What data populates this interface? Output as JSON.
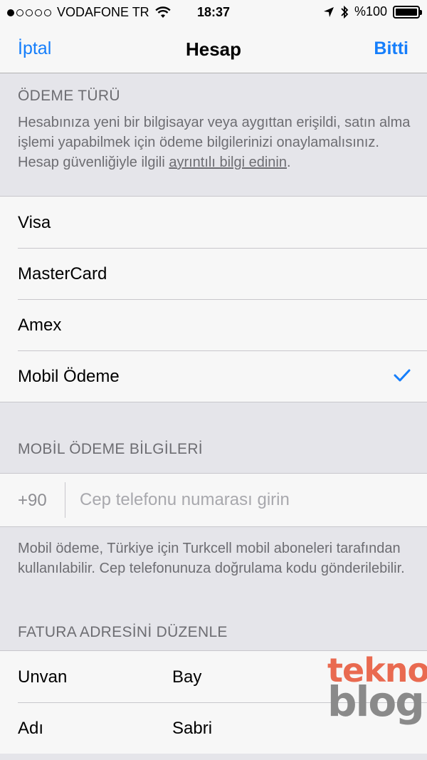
{
  "status_bar": {
    "carrier": "VODAFONE TR",
    "time": "18:37",
    "battery": "%100",
    "signal_dots_filled": 1,
    "signal_dots_total": 5
  },
  "nav": {
    "cancel": "İptal",
    "title": "Hesap",
    "done": "Bitti"
  },
  "payment_type": {
    "header": "ÖDEME TÜRÜ",
    "description": "Hesabınıza yeni bir bilgisayar veya aygıttan erişildi, satın alma işlemi yapabilmek için ödeme bilgilerinizi onaylamalısınız. Hesap güvenliğiyle ilgili ",
    "link": "ayrıntılı bilgi edinin",
    "description_end": ".",
    "options": [
      {
        "label": "Visa",
        "selected": false
      },
      {
        "label": "MasterCard",
        "selected": false
      },
      {
        "label": "Amex",
        "selected": false
      },
      {
        "label": "Mobil Ödeme",
        "selected": true
      }
    ]
  },
  "mobile_payment": {
    "header": "MOBİL ÖDEME BİLGİLERİ",
    "country_code": "+90",
    "phone_placeholder": "Cep telefonu numarası girin",
    "phone_value": "",
    "footer": "Mobil ödeme, Türkiye için Turkcell mobil aboneleri tarafından kullanılabilir. Cep telefonunuza doğrulama kodu gönderilebilir."
  },
  "billing": {
    "header": "FATURA ADRESİNİ DÜZENLE",
    "rows": [
      {
        "label": "Unvan",
        "value": "Bay"
      },
      {
        "label": "Adı",
        "value": "Sabri"
      }
    ]
  },
  "watermark": {
    "line1": "tekno",
    "line2": "blog"
  },
  "colors": {
    "accent": "#157efb",
    "secondary_text": "#6d6d72",
    "group_bg": "#e5e5ea",
    "cell_bg": "#f7f7f7"
  }
}
